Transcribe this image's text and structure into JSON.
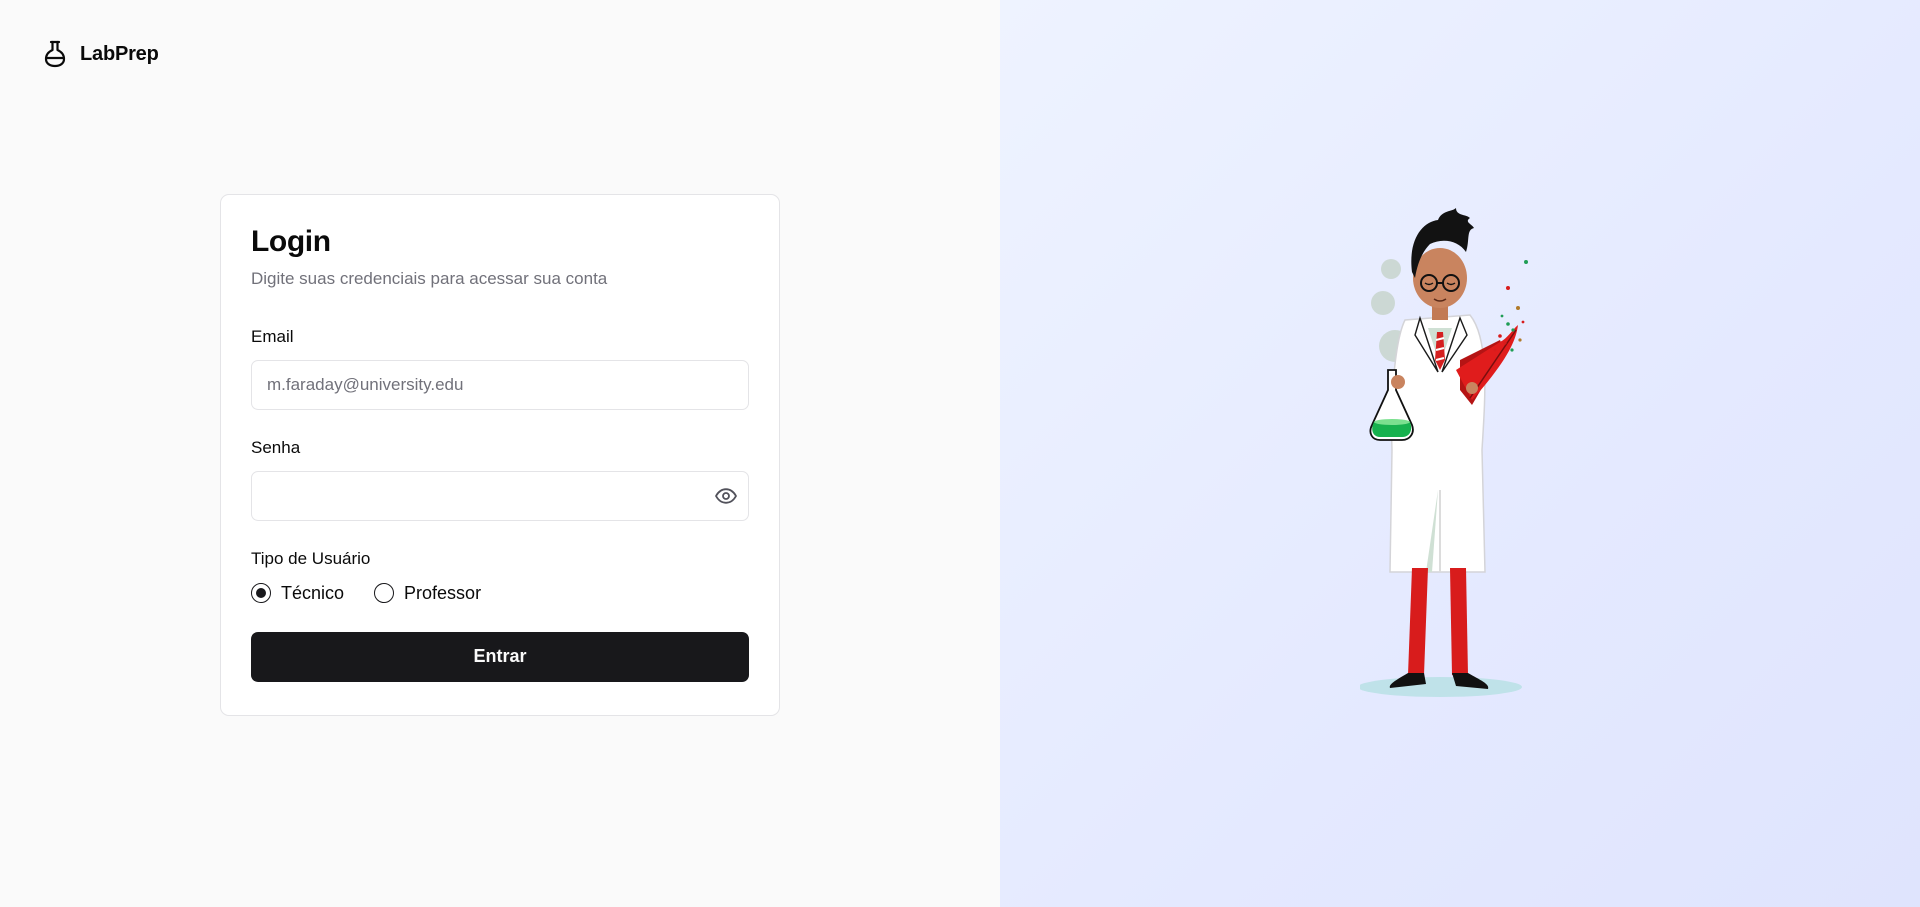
{
  "brand": {
    "name": "LabPrep",
    "icon": "flask-icon"
  },
  "login": {
    "title": "Login",
    "subtitle": "Digite suas credenciais para acessar sua conta",
    "email": {
      "label": "Email",
      "placeholder": "m.faraday@university.edu",
      "value": ""
    },
    "password": {
      "label": "Senha",
      "value": "",
      "toggle_icon": "eye-icon"
    },
    "user_type": {
      "label": "Tipo de Usuário",
      "options": [
        {
          "label": "Técnico",
          "selected": true
        },
        {
          "label": "Professor",
          "selected": false
        }
      ]
    },
    "submit_label": "Entrar"
  },
  "colors": {
    "primary": "#18181b",
    "muted_text": "#71717a",
    "border": "#e4e4e7",
    "left_bg": "#fafafa",
    "right_bg": "#e8edff"
  }
}
